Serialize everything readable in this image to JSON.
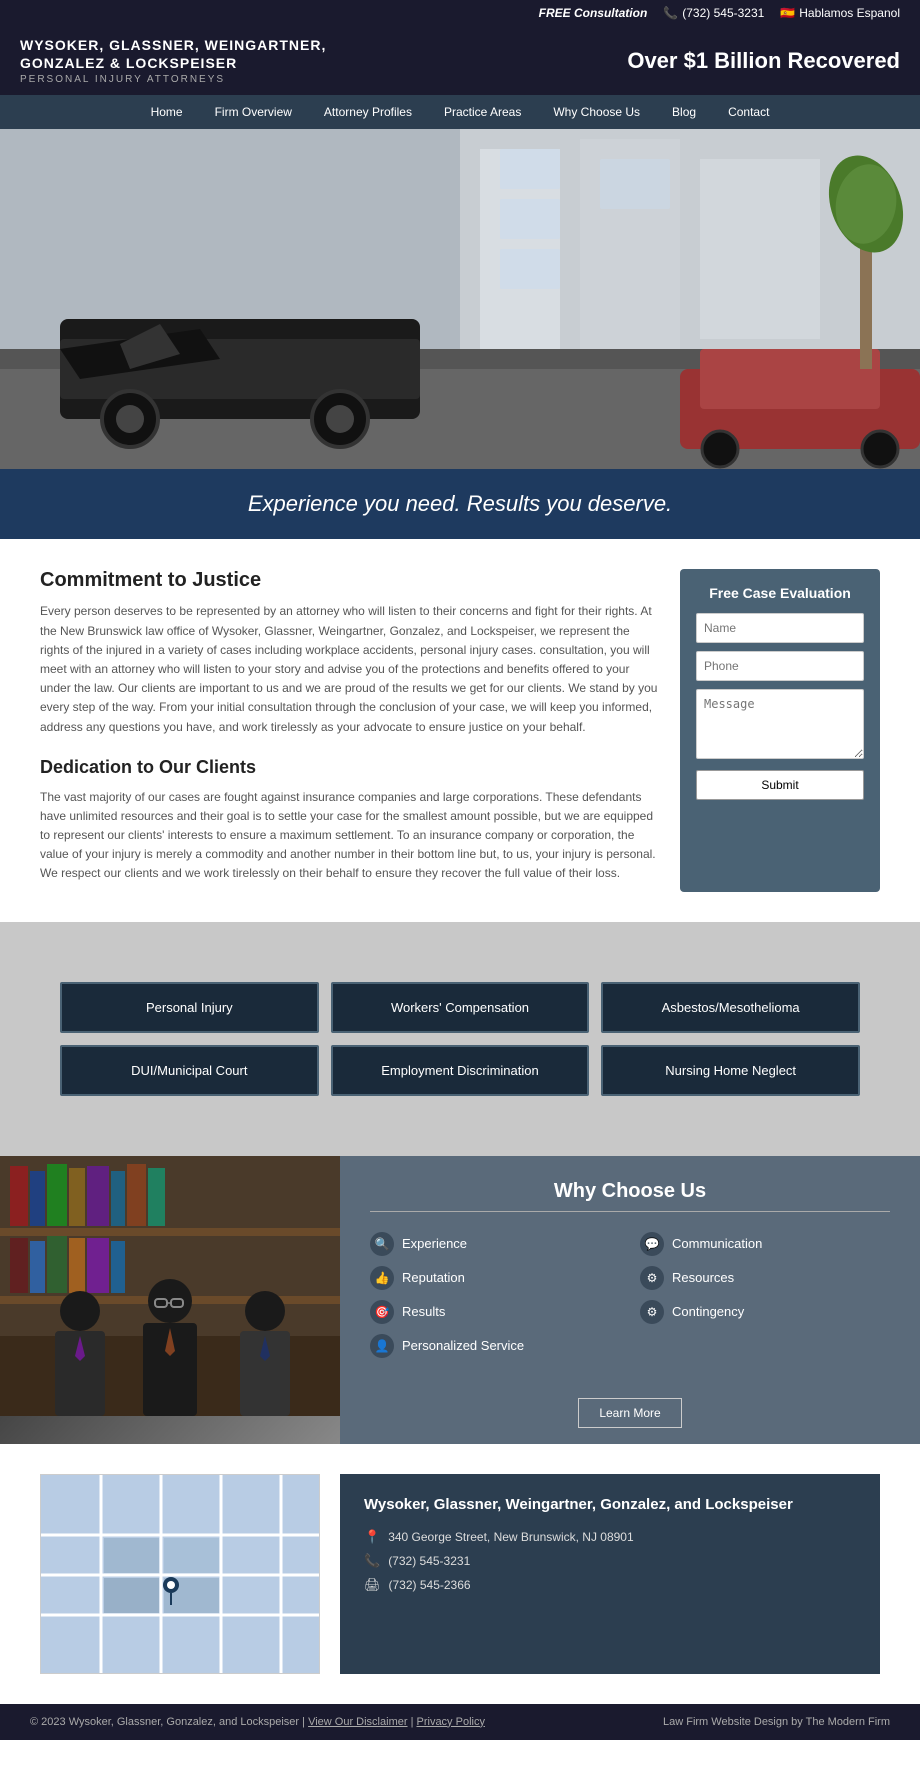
{
  "topbar": {
    "free_consult": "FREE Consultation",
    "phone": "(732) 545-3231",
    "spanish": "Hablamos Espanol"
  },
  "header": {
    "firm_name_line1": "Wysoker, Glassner, Weingartner,",
    "firm_name_line2": "Gonzalez & Lockspeiser",
    "tagline": "Personal Injury Attorneys",
    "slogan": "Over $1 Billion Recovered"
  },
  "nav": {
    "items": [
      {
        "label": "Home",
        "href": "#"
      },
      {
        "label": "Firm Overview",
        "href": "#"
      },
      {
        "label": "Attorney Profiles",
        "href": "#"
      },
      {
        "label": "Practice Areas",
        "href": "#"
      },
      {
        "label": "Why Choose Us",
        "href": "#"
      },
      {
        "label": "Blog",
        "href": "#"
      },
      {
        "label": "Contact",
        "href": "#"
      }
    ]
  },
  "banner": {
    "text": "Experience you need. Results you deserve."
  },
  "commitment": {
    "heading1": "Commitment to Justice",
    "body1": "Every person deserves to be represented by an attorney who will listen to their concerns and fight for their rights. At the New Brunswick law office of Wysoker, Glassner, Weingartner, Gonzalez, and Lockspeiser, we represent the rights of the injured in a variety of cases including workplace accidents, personal injury cases. consultation, you will meet with an attorney who will listen to your story and advise you of the protections and benefits offered to your under the law. Our clients are important to us and we are proud of the results we get for our clients. We stand by you every step of the way. From your initial consultation through the conclusion of your case, we will keep you informed, address any questions you have, and work tirelessly as your advocate to ensure justice on your behalf.",
    "heading2": "Dedication to Our Clients",
    "body2": "The vast majority of our cases are fought against insurance companies and large corporations. These defendants have unlimited resources and their goal is to settle your case for the smallest amount possible, but we are equipped to represent our clients' interests to ensure a maximum settlement. To an insurance company or corporation, the value of your injury is merely a commodity and another number in their bottom line but, to us, your injury is personal. We respect our clients and we work tirelessly on their behalf to ensure they recover the full value of their loss."
  },
  "case_eval": {
    "heading": "Free Case Evaluation",
    "name_placeholder": "Name",
    "phone_placeholder": "Phone",
    "message_placeholder": "Message",
    "submit_label": "Submit"
  },
  "practice_areas": {
    "buttons": [
      "Personal Injury",
      "Workers' Compensation",
      "Asbestos/Mesothelioma",
      "DUI/Municipal Court",
      "Employment Discrimination",
      "Nursing Home Neglect"
    ]
  },
  "why_choose": {
    "heading": "Why Choose Us",
    "items": [
      {
        "label": "Experience",
        "icon": "🔍"
      },
      {
        "label": "Communication",
        "icon": "💬"
      },
      {
        "label": "Reputation",
        "icon": "👍"
      },
      {
        "label": "Resources",
        "icon": "⚙"
      },
      {
        "label": "Results",
        "icon": "🎯"
      },
      {
        "label": "Contingency",
        "icon": "⚙"
      },
      {
        "label": "Personalized Service",
        "icon": "👤"
      }
    ],
    "learn_more": "Learn More"
  },
  "contact": {
    "firm_name": "Wysoker, Glassner, Weingartner, Gonzalez, and Lockspeiser",
    "address": "340 George Street, New Brunswick, NJ 08901",
    "phone": "(732) 545-3231",
    "fax": "(732) 545-2366"
  },
  "footer": {
    "copyright": "© 2023 Wysoker, Glassner, Gonzalez, and Lockspeiser",
    "disclaimer": "View Our Disclaimer",
    "privacy": "Privacy Policy",
    "credit": "Law Firm Website Design by The Modern Firm"
  }
}
